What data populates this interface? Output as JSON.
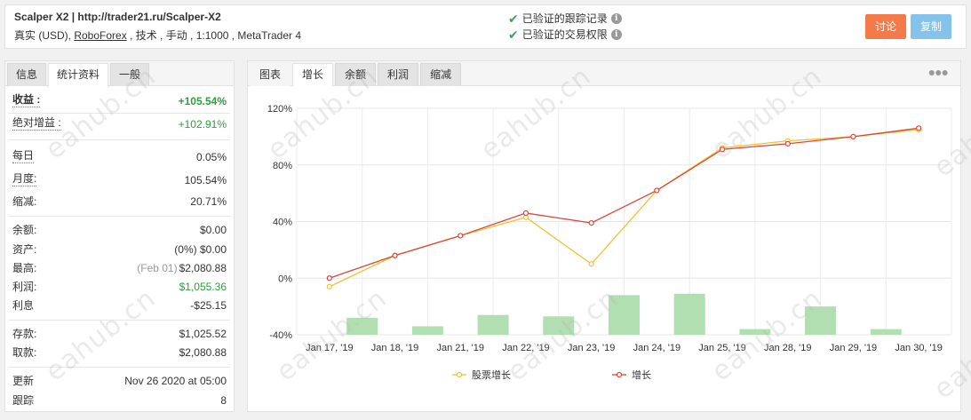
{
  "header": {
    "title": "Scalper X2 | http://trader21.ru/Scalper-X2",
    "sub_prefix": "真实 (USD), ",
    "broker": "RoboForex",
    "sub_suffix": " , 技术 , 手动 , 1:1000 , MetaTrader 4",
    "verified_track": "已验证的跟踪记录",
    "verified_trade": "已验证的交易权限",
    "btn_discuss": "讨论",
    "btn_copy": "复制",
    "colors": {
      "discuss": "#f47a4a",
      "copy": "#86c3ea",
      "check": "#3aa55a"
    }
  },
  "left_tabs": [
    "信息",
    "统计资料",
    "一般"
  ],
  "stats": {
    "gain_label": "收益 :",
    "gain_value": "+105.54%",
    "abs_gain_label": "绝对增益 :",
    "abs_gain_value": "+102.91%",
    "daily_label": "每日",
    "daily_value": "0.05%",
    "monthly_label": "月度:",
    "monthly_value": "105.54%",
    "drawdown_label": "缩减:",
    "drawdown_value": "20.71%",
    "balance_label": "余额:",
    "balance_value": "$0.00",
    "equity_label": "资产:",
    "equity_value": "(0%) $0.00",
    "highest_label": "最高:",
    "highest_date": "(Feb 01)",
    "highest_value": "$2,080.88",
    "profit_label": "利润:",
    "profit_value": "$1,055.36",
    "interest_label": "利息",
    "interest_value": "-$25.15",
    "deposits_label": "存款:",
    "deposits_value": "$1,025.52",
    "withdrawals_label": "取款:",
    "withdrawals_value": "$2,080.88",
    "updated_label": "更新",
    "updated_value": "Nov 26 2020 at 05:00",
    "tracking_label": "跟踪",
    "tracking_value": "8"
  },
  "chart_tabs": [
    "图表",
    "增长",
    "余额",
    "利润",
    "缩减"
  ],
  "watermark": "eahub.cn",
  "chart_data": {
    "type": "line",
    "categories": [
      "Jan 17, '19",
      "Jan 18, '19",
      "Jan 21, '19",
      "Jan 22, '19",
      "Jan 23, '19",
      "Jan 24, '19",
      "Jan 25, '19",
      "Jan 28, '19",
      "Jan 29, '19",
      "Jan 30, '19"
    ],
    "y_ticks": [
      "120%",
      "80%",
      "40%",
      "0%",
      "-40%"
    ],
    "ylim": [
      -40,
      120
    ],
    "series": [
      {
        "name": "股票增长",
        "color": "#f2c12e",
        "values": [
          -6,
          16,
          30,
          43,
          10,
          62,
          92,
          97,
          100,
          105
        ]
      },
      {
        "name": "增长",
        "color": "#d9463a",
        "values": [
          0,
          16,
          30,
          46,
          39,
          62,
          91,
          95,
          100,
          106
        ]
      }
    ],
    "bars": {
      "color": "#b2dfb2",
      "values": [
        -28,
        -34,
        -26,
        -27,
        -12,
        -11,
        -36,
        -20,
        -36
      ]
    },
    "grid": true,
    "legend": "bottom"
  }
}
